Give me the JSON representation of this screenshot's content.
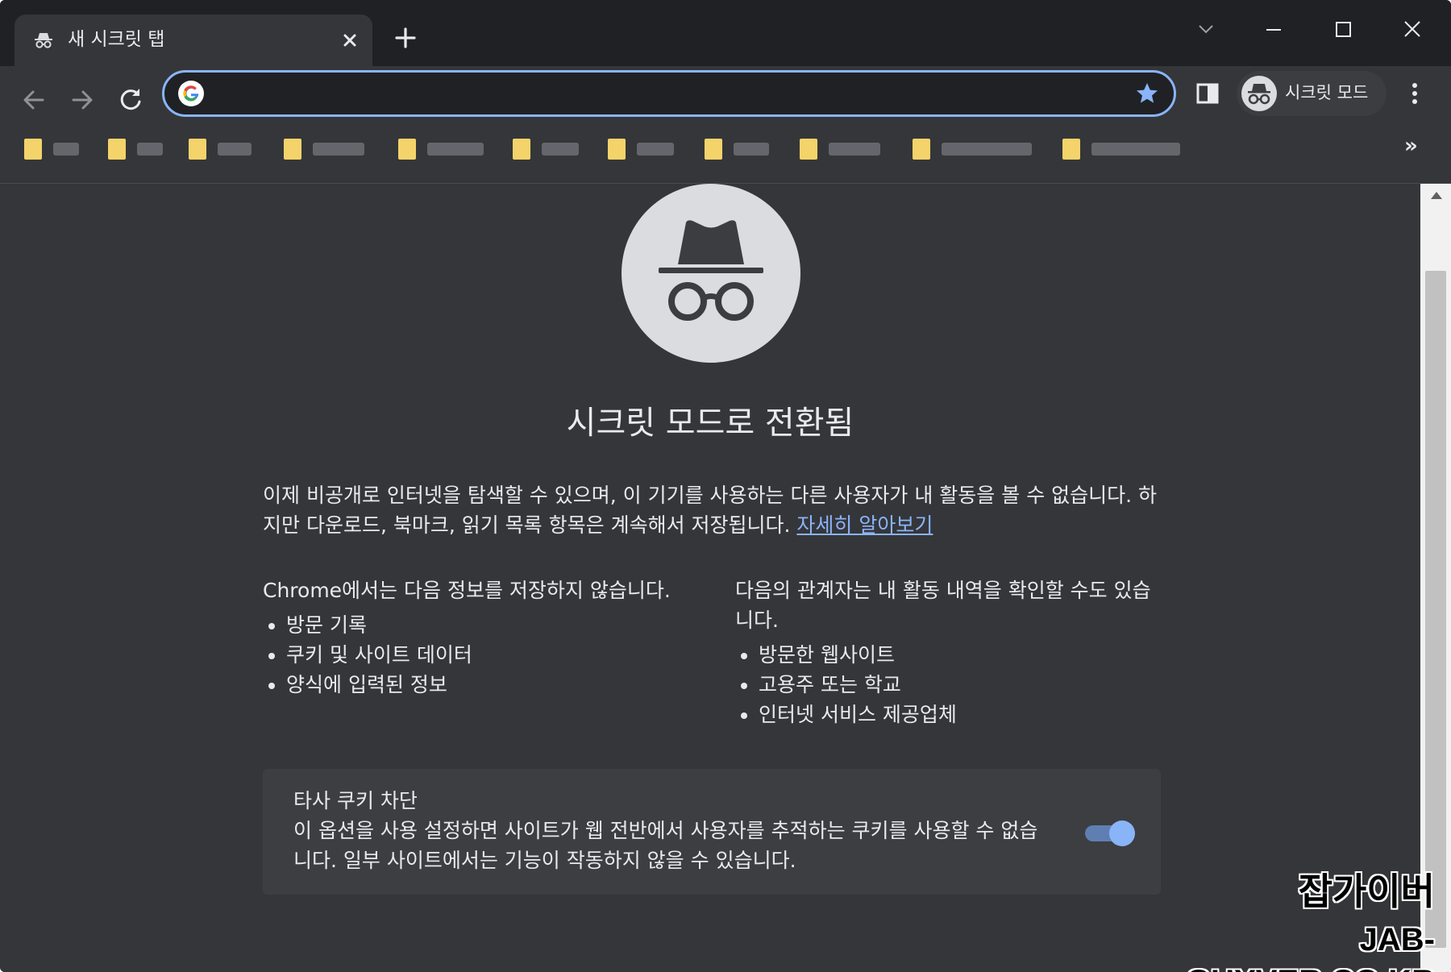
{
  "tab": {
    "title": "새 시크릿 탭"
  },
  "omnibox": {
    "value": "",
    "placeholder": ""
  },
  "profile": {
    "label": "시크릿 모드"
  },
  "bookmarks": {
    "more_label": "»",
    "count": 12
  },
  "content": {
    "heading": "시크릿 모드로 전환됨",
    "intro": "이제 비공개로 인터넷을 탐색할 수 있으며, 이 기기를 사용하는 다른 사용자가 내 활동을 볼 수 없습니다. 하지만 다운로드, 북마크, 읽기 목록 항목은 계속해서 저장됩니다. ",
    "learn_more": "자세히 알아보기",
    "left_column": {
      "title": "Chrome에서는 다음 정보를 저장하지 않습니다.",
      "items": [
        "방문 기록",
        "쿠키 및 사이트 데이터",
        "양식에 입력된 정보"
      ]
    },
    "right_column": {
      "title": "다음의 관계자는 내 활동 내역을 확인할 수도 있습니다.",
      "items": [
        "방문한 웹사이트",
        "고용주 또는 학교",
        "인터넷 서비스 제공업체"
      ]
    },
    "cookie_card": {
      "title": "타사 쿠키 차단",
      "description": "이 옵션을 사용 설정하면 사이트가 웹 전반에서 사용자를 추적하는 쿠키를 사용할 수 없습니다. 일부 사이트에서는 기능이 작동하지 않을 수 있습니다.",
      "toggle_on": true
    }
  },
  "watermark": {
    "line1": "잡가이버",
    "line2": "JAB-GUYVER.CO.KR"
  },
  "colors": {
    "frame": "#202124",
    "toolbar": "#35363a",
    "accent": "#8ab4f8",
    "text": "#e8eaed",
    "bookmark_folder": "#f4d36a"
  },
  "icons": {
    "tab": "incognito-icon",
    "close": "close-icon",
    "new_tab": "plus-icon",
    "back": "arrow-left-icon",
    "forward": "arrow-right-icon",
    "reload": "reload-icon",
    "google": "google-g-icon",
    "star": "star-icon",
    "side_panel": "side-panel-icon",
    "menu": "kebab-menu-icon"
  }
}
